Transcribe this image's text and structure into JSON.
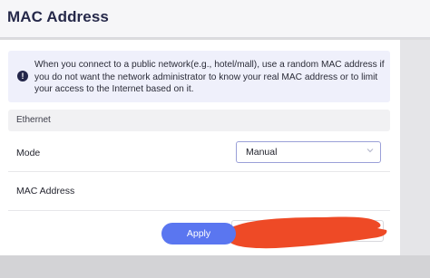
{
  "header": {
    "title": "MAC Address"
  },
  "notice": {
    "icon": "info-icon",
    "text": "When you connect to a public network(e.g., hotel/mall), use a random MAC address if you do not want the network administrator to know your real MAC address or to limit your access to the Internet based on it."
  },
  "section": {
    "title": "Ethernet"
  },
  "mode": {
    "label": "Mode",
    "selected": "Manual"
  },
  "mac_address": {
    "label": "MAC Address",
    "value_redacted": true
  },
  "actions": {
    "apply_label": "Apply"
  },
  "colors": {
    "accent": "#5a76f0",
    "title": "#26294a",
    "notice_bg": "#eff0fb",
    "redaction": "#ee4a26"
  }
}
